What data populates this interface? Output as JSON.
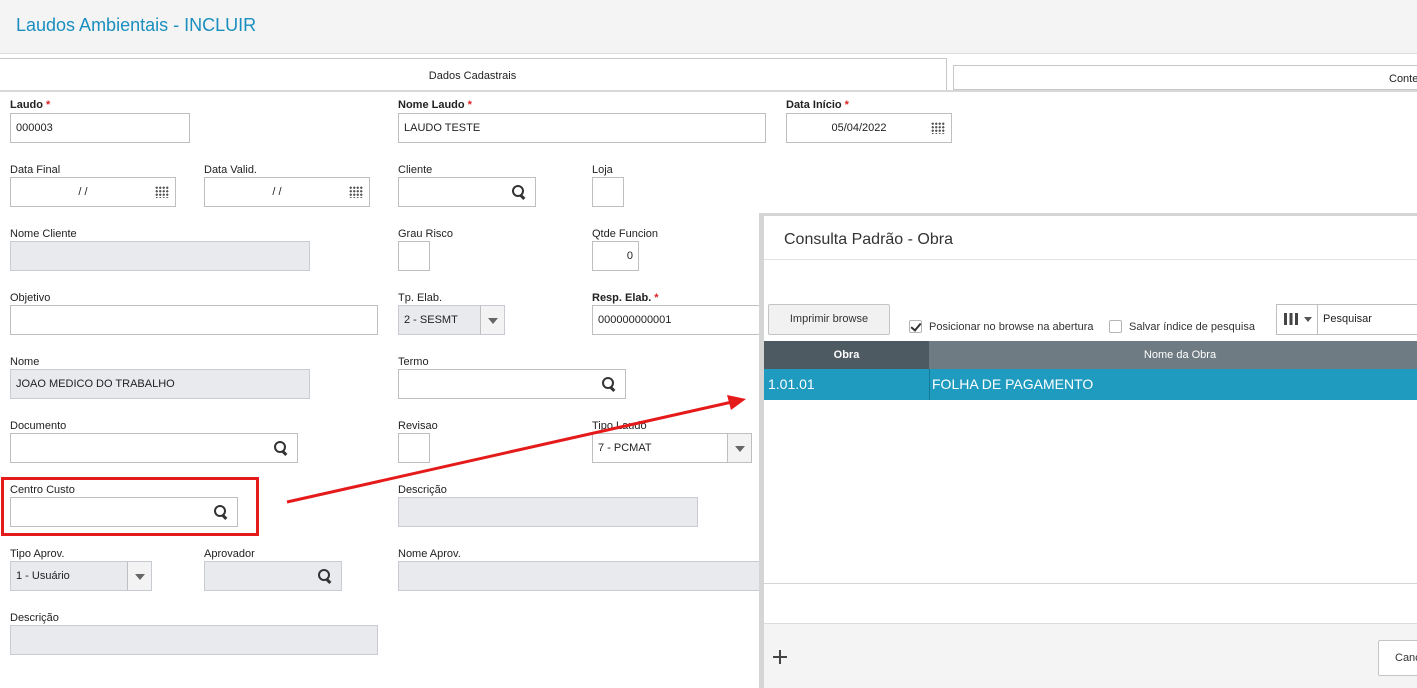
{
  "window": {
    "title": "Laudos Ambientais - INCLUIR"
  },
  "tabs": [
    {
      "label": "Dados Cadastrais",
      "active": true
    },
    {
      "label": "Conte",
      "active": false
    }
  ],
  "form": {
    "laudo": {
      "label": "Laudo",
      "value": "000003",
      "required": "*"
    },
    "nome_laudo": {
      "label": "Nome Laudo",
      "value": "LAUDO TESTE",
      "required": "*"
    },
    "data_inicio": {
      "label": "Data Início",
      "value": "05/04/2022",
      "required": "*"
    },
    "data_final": {
      "label": "Data Final",
      "value": "/  /"
    },
    "data_valid": {
      "label": "Data Valid.",
      "value": "/  /"
    },
    "cliente": {
      "label": "Cliente",
      "value": ""
    },
    "loja": {
      "label": "Loja",
      "value": ""
    },
    "nome_cliente": {
      "label": "Nome Cliente",
      "value": ""
    },
    "grau_risco": {
      "label": "Grau Risco",
      "value": ""
    },
    "qtde_funcion": {
      "label": "Qtde Funcion",
      "value": "0"
    },
    "objetivo": {
      "label": "Objetivo",
      "value": ""
    },
    "tp_elab": {
      "label": "Tp. Elab.",
      "value": "2 - SESMT"
    },
    "resp_elab": {
      "label": "Resp. Elab.",
      "value": "000000000001",
      "required": "*"
    },
    "nome": {
      "label": "Nome",
      "value": "JOAO MEDICO DO TRABALHO"
    },
    "termo": {
      "label": "Termo",
      "value": ""
    },
    "documento": {
      "label": "Documento",
      "value": ""
    },
    "revisao": {
      "label": "Revisao",
      "value": ""
    },
    "tipo_laudo": {
      "label": "Tipo Laudo",
      "value": "7 - PCMAT"
    },
    "centro_custo": {
      "label": "Centro Custo",
      "value": ""
    },
    "descricao1": {
      "label": "Descrição",
      "value": ""
    },
    "tipo_aprov": {
      "label": "Tipo Aprov.",
      "value": "1 - Usuário"
    },
    "aprovador": {
      "label": "Aprovador",
      "value": ""
    },
    "nome_aprov": {
      "label": "Nome Aprov.",
      "value": ""
    },
    "descricao2": {
      "label": "Descrição",
      "value": ""
    }
  },
  "dialog": {
    "title": "Consulta Padrão - Obra",
    "print_button": "Imprimir browse",
    "checkbox_position": {
      "label": "Posicionar no browse na abertura",
      "checked": true
    },
    "checkbox_save_index": {
      "label": "Salvar índice de pesquisa",
      "checked": false
    },
    "search_combo": "Pesquisar",
    "columns": [
      "Obra",
      "Nome da Obra"
    ],
    "rows": [
      {
        "obra": "1.01.01",
        "nome": "FOLHA DE PAGAMENTO"
      }
    ],
    "cancel_button": "Canc"
  },
  "colors": {
    "accent": "#1a8fbf",
    "selected_row": "#1e9bbf",
    "annotation": "#e51b1b",
    "grid_header": "#6f7b83"
  },
  "icons": [
    "search-icon",
    "calendar-icon",
    "chevron-down-icon",
    "columns-icon",
    "move-icon",
    "check-icon"
  ]
}
